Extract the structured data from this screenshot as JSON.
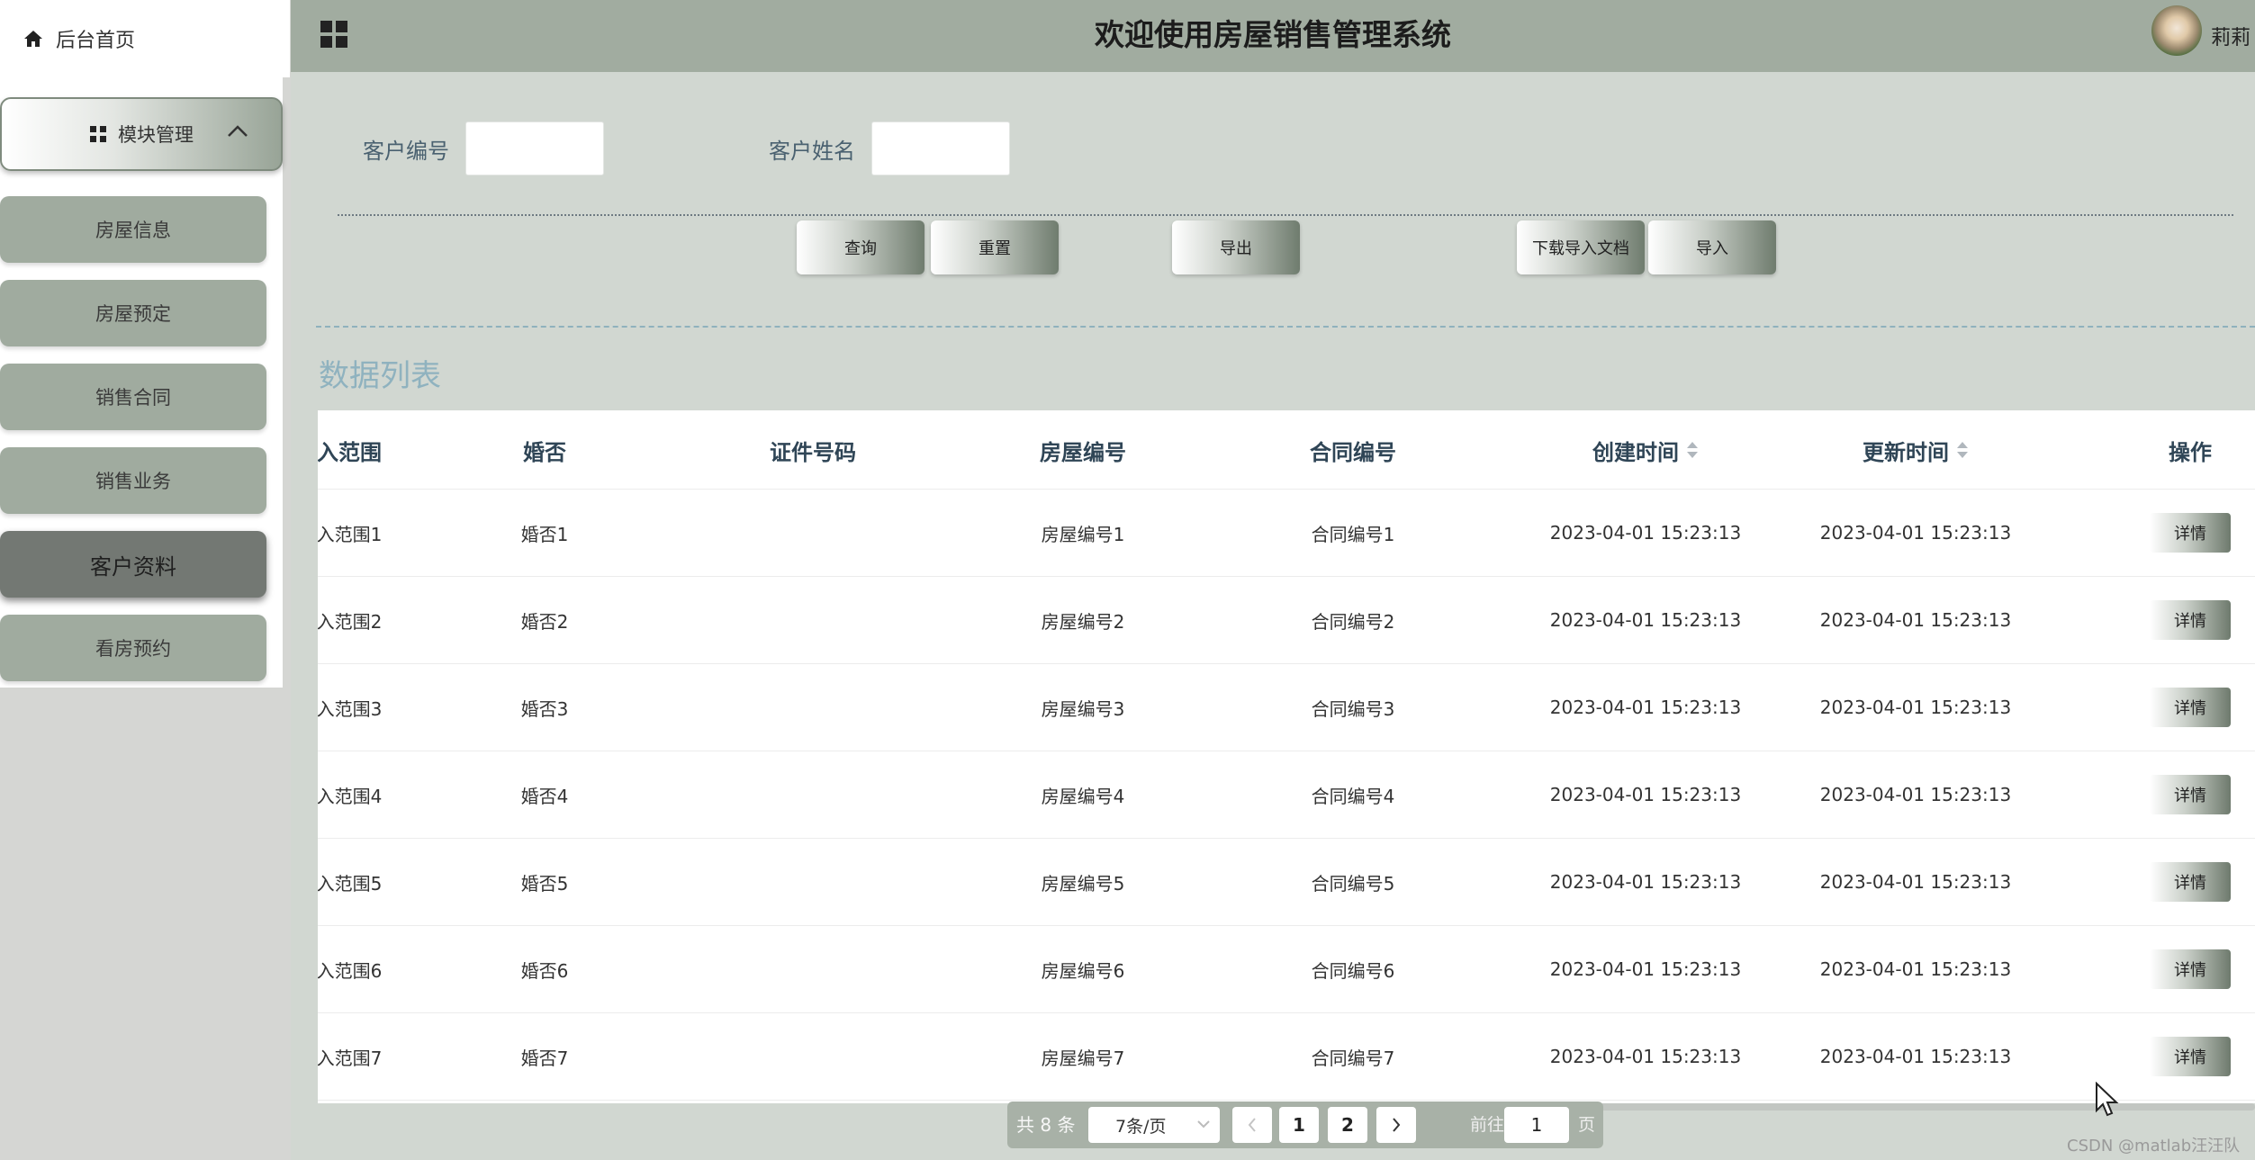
{
  "sidebar": {
    "home_label": "后台首页",
    "module_label": "模块管理",
    "items": [
      {
        "label": "房屋信息"
      },
      {
        "label": "房屋预定"
      },
      {
        "label": "销售合同"
      },
      {
        "label": "销售业务"
      },
      {
        "label": "客户资料",
        "active": true
      },
      {
        "label": "看房预约"
      }
    ]
  },
  "header": {
    "title": "欢迎使用房屋销售管理系统",
    "user_name": "莉莉"
  },
  "search": {
    "fields": [
      {
        "label": "客户编号",
        "value": ""
      },
      {
        "label": "客户姓名",
        "value": ""
      }
    ],
    "buttons": {
      "query": "查询",
      "reset": "重置",
      "export": "导出",
      "download_template": "下载导入文档",
      "import": "导入"
    }
  },
  "list": {
    "title": "数据列表",
    "columns": [
      "入范围",
      "婚否",
      "证件号码",
      "房屋编号",
      "合同编号",
      "创建时间",
      "更新时间",
      "操作"
    ],
    "rows": [
      {
        "range": "入范围1",
        "married": "婚否1",
        "id_no": "",
        "house_no": "房屋编号1",
        "contract_no": "合同编号1",
        "created": "2023-04-01 15:23:13",
        "updated": "2023-04-01 15:23:13",
        "action": "详情"
      },
      {
        "range": "入范围2",
        "married": "婚否2",
        "id_no": "",
        "house_no": "房屋编号2",
        "contract_no": "合同编号2",
        "created": "2023-04-01 15:23:13",
        "updated": "2023-04-01 15:23:13",
        "action": "详情"
      },
      {
        "range": "入范围3",
        "married": "婚否3",
        "id_no": "",
        "house_no": "房屋编号3",
        "contract_no": "合同编号3",
        "created": "2023-04-01 15:23:13",
        "updated": "2023-04-01 15:23:13",
        "action": "详情"
      },
      {
        "range": "入范围4",
        "married": "婚否4",
        "id_no": "",
        "house_no": "房屋编号4",
        "contract_no": "合同编号4",
        "created": "2023-04-01 15:23:13",
        "updated": "2023-04-01 15:23:13",
        "action": "详情"
      },
      {
        "range": "入范围5",
        "married": "婚否5",
        "id_no": "",
        "house_no": "房屋编号5",
        "contract_no": "合同编号5",
        "created": "2023-04-01 15:23:13",
        "updated": "2023-04-01 15:23:13",
        "action": "详情"
      },
      {
        "range": "入范围6",
        "married": "婚否6",
        "id_no": "",
        "house_no": "房屋编号6",
        "contract_no": "合同编号6",
        "created": "2023-04-01 15:23:13",
        "updated": "2023-04-01 15:23:13",
        "action": "详情"
      },
      {
        "range": "入范围7",
        "married": "婚否7",
        "id_no": "",
        "house_no": "房屋编号7",
        "contract_no": "合同编号7",
        "created": "2023-04-01 15:23:13",
        "updated": "2023-04-01 15:23:13",
        "action": "详情"
      }
    ]
  },
  "pagination": {
    "total_text": "共 8 条",
    "page_size": "7条/页",
    "pages": [
      "1",
      "2"
    ],
    "current_page": "1",
    "jump_label": "前往",
    "jump_value": "1",
    "jump_suffix": "页"
  },
  "watermark": "CSDN @matlab汪汪队"
}
